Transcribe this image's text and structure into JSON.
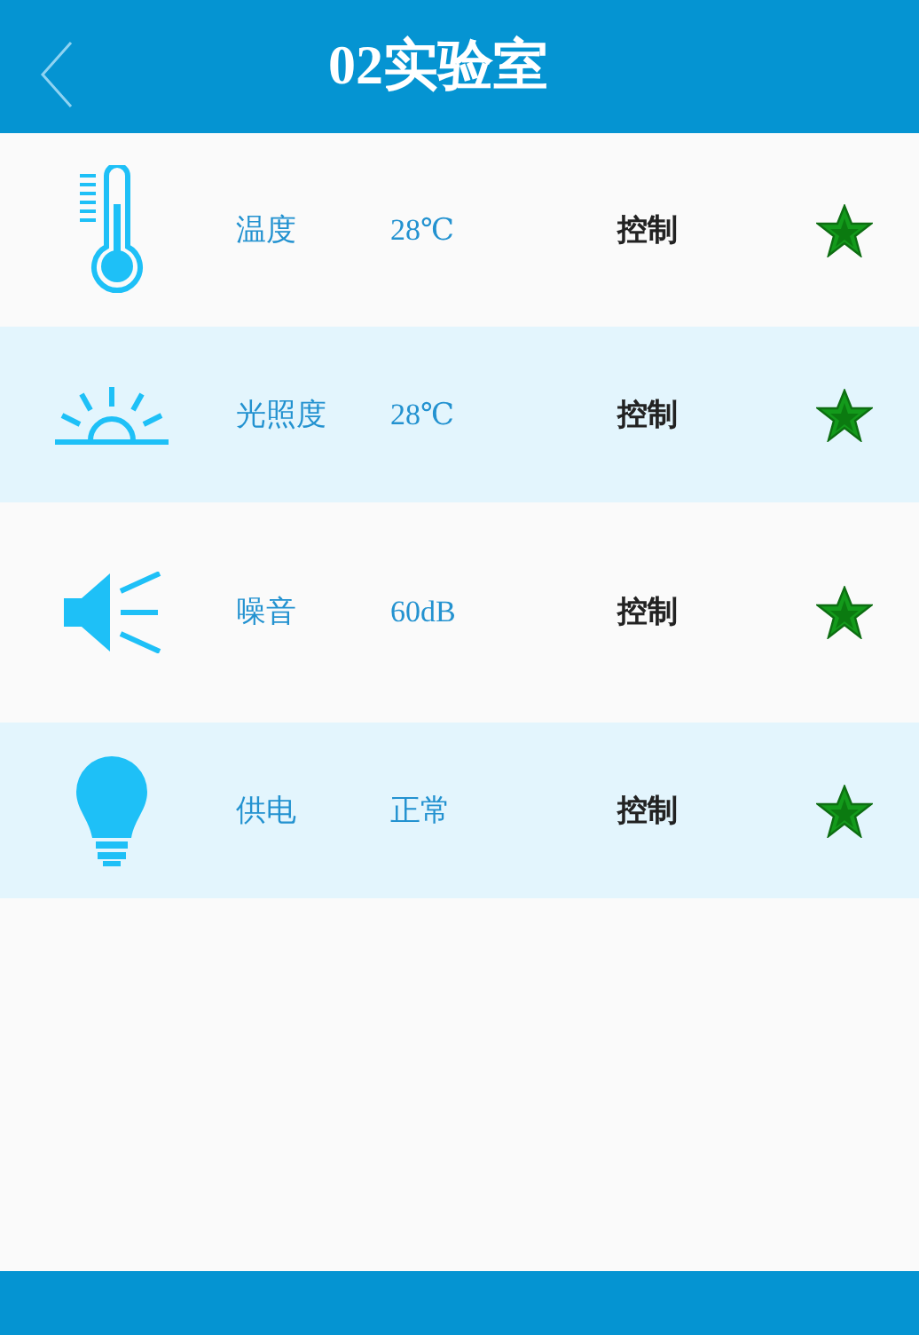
{
  "header": {
    "title": "02实验室"
  },
  "rows": [
    {
      "kind": "thermometer",
      "label": "温度",
      "value": "28℃",
      "control": "控制",
      "starred": true
    },
    {
      "kind": "sun",
      "label": "光照度",
      "value": "28℃",
      "control": "控制",
      "starred": true
    },
    {
      "kind": "speaker",
      "label": "噪音",
      "value": "60dB",
      "control": "控制",
      "starred": true
    },
    {
      "kind": "bulb",
      "label": "供电",
      "value": "正常",
      "control": "控制",
      "starred": true
    }
  ]
}
